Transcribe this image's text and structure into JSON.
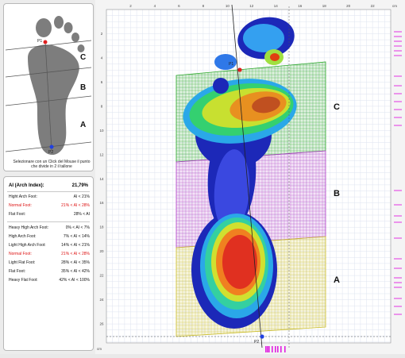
{
  "diagram": {
    "point_labels": {
      "p1": "P1",
      "p2": "P2"
    },
    "zones": [
      "C",
      "B",
      "A"
    ],
    "instruction": "Selezionare con un Click del Mouse il punto che divide in 2 il tallone"
  },
  "arch_index": {
    "label": "AI (Arch Index):",
    "value": "21,79%"
  },
  "classification_groups": [
    [
      {
        "label": "Hight Arch Foot:",
        "range": "AI < 21%",
        "highlight": false
      },
      {
        "label": "Normal Foot:",
        "range": "21% < AI < 28%",
        "highlight": true
      },
      {
        "label": "Flat Foot:",
        "range": "28% < AI",
        "highlight": false
      }
    ],
    [
      {
        "label": "Heavy High Arch Foot:",
        "range": "0% < AI < 7%",
        "highlight": false
      },
      {
        "label": "High Arch Foot:",
        "range": "7% < AI < 14%",
        "highlight": false
      },
      {
        "label": "Light High Arch Foot:",
        "range": "14% < AI < 21%",
        "highlight": false
      },
      {
        "label": "Normal Foot:",
        "range": "21% < AI < 28%",
        "highlight": true
      },
      {
        "label": "Light Flat Foot:",
        "range": "28% < AI < 35%",
        "highlight": false
      },
      {
        "label": "Flat Foot:",
        "range": "35% < AI < 42%",
        "highlight": false
      },
      {
        "label": "Heavy Flat Foot:",
        "range": "42% < AI < 100%",
        "highlight": false
      }
    ]
  ],
  "plot": {
    "unit": "cm",
    "x_ticks": [
      2,
      4,
      6,
      8,
      10,
      12,
      14,
      16,
      18,
      20,
      22
    ],
    "y_ticks": [
      2,
      4,
      6,
      8,
      10,
      12,
      14,
      16,
      18,
      20,
      22,
      24,
      26
    ],
    "zone_labels": [
      "C",
      "B",
      "A"
    ],
    "point_labels": {
      "p1": "P1",
      "p2": "P2"
    },
    "colors": {
      "zone_c": "#2aa62a",
      "zone_b": "#b040c8",
      "zone_a": "#cbbd2c",
      "marker": "#e020e0"
    }
  }
}
